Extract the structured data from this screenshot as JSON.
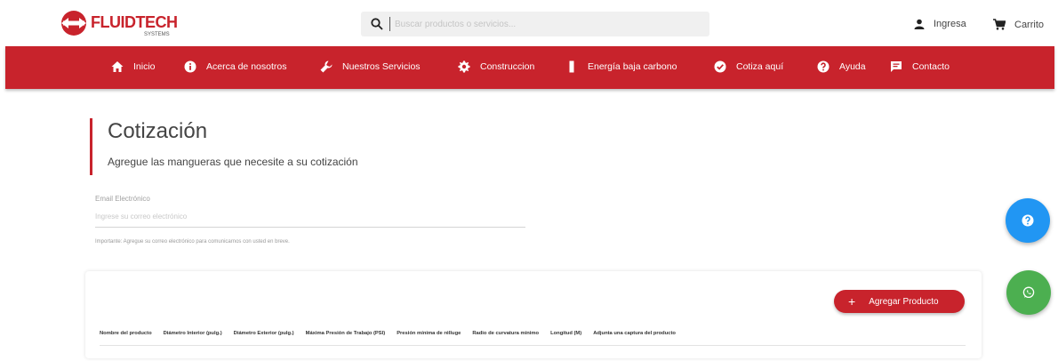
{
  "header": {
    "logo_text": "FLUIDTECH",
    "logo_sub": "SYSTEMS",
    "search_placeholder": "Buscar productos o servicios...",
    "ingresa_label": "Ingresa",
    "carrito_label": "Carrito"
  },
  "nav": {
    "items": [
      {
        "label": "Inicio",
        "icon": "home-icon"
      },
      {
        "label": "Acerca de nosotros",
        "icon": "info-icon"
      },
      {
        "label": "Nuestros Servicios",
        "icon": "wrench-icon"
      },
      {
        "label": "Construccion",
        "icon": "gear-icon"
      },
      {
        "label": "Energía baja carbono",
        "icon": "battery-icon"
      },
      {
        "label": "Cotiza aquí",
        "icon": "check-circle-icon"
      },
      {
        "label": "Ayuda",
        "icon": "help-icon"
      },
      {
        "label": "Contacto",
        "icon": "chat-icon"
      }
    ]
  },
  "page": {
    "title": "Cotización",
    "subtitle": "Agregue las mangueras que necesite a su cotización"
  },
  "email": {
    "label": "Email Electrónico",
    "placeholder": "Ingrese su correo electrónico",
    "hint": "Importante: Agregue su correo electrónico para comunicarnos con usted en breve."
  },
  "card": {
    "add_button_label": "Agregar Producto",
    "columns": [
      "Nombre del producto",
      "Diámetro Interior (pulg.)",
      "Diámetro Exterior (pulg.)",
      "Máxima Presión de Trabajo (PSI)",
      "Presión mínima de rélluge",
      "Radio de curvatura mínimo",
      "Longitud (M)",
      "Adjunta una captura del producto"
    ]
  },
  "colors": {
    "brand_red": "#c8232c",
    "help_blue": "#2196f3",
    "whatsapp_green": "#4caf50"
  }
}
